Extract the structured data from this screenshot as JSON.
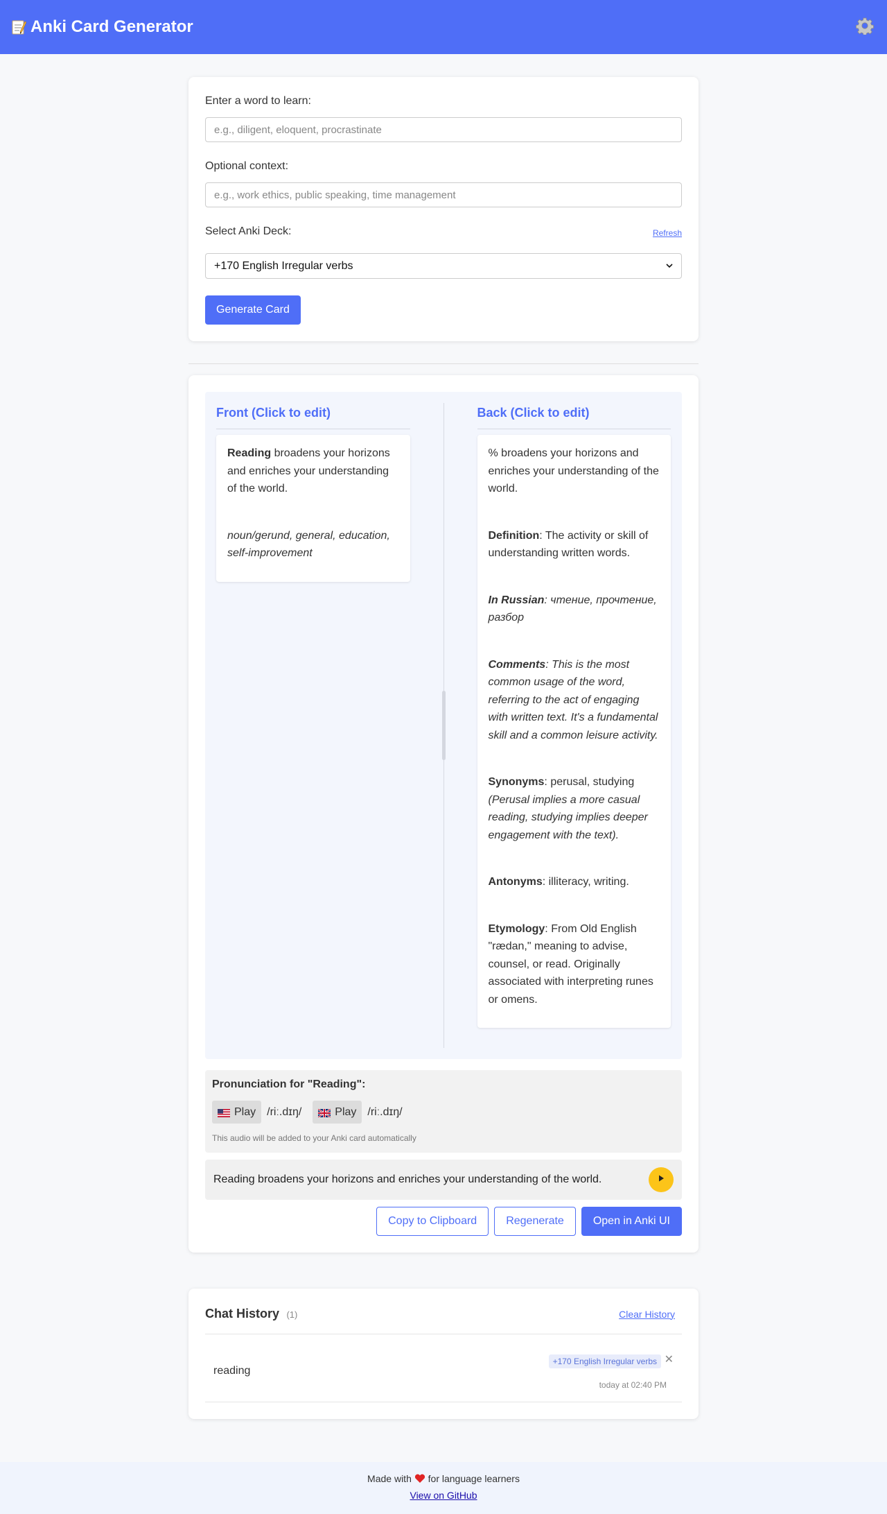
{
  "header": {
    "title": "Anki Card Generator",
    "icon": "memo-icon",
    "settings_icon": "gear-icon"
  },
  "form": {
    "word_label": "Enter a word to learn:",
    "word_placeholder": "e.g., diligent, eloquent, procrastinate",
    "word_value": "",
    "context_label": "Optional context:",
    "context_placeholder": "e.g., work ethics, public speaking, time management",
    "context_value": "",
    "deck_label": "Select Anki Deck:",
    "refresh_label": "Refresh",
    "deck_selected": "+170 English Irregular verbs",
    "generate_label": "Generate Card"
  },
  "card": {
    "front_title": "Front (Click to edit)",
    "front_word": "Reading",
    "front_sentence_rest": " broadens your horizons and enriches your understanding of the world.",
    "front_tags": "noun/gerund, general, education, self-improvement",
    "back_title": "Back (Click to edit)",
    "back_sentence": "% broadens your horizons and enriches your understanding of the world.",
    "definition_label": "Definition",
    "definition_text": ": The activity or skill of understanding written words.",
    "russian_label": "In Russian",
    "russian_text": ": чтение, прочтение, разбор",
    "comments_label": "Comments",
    "comments_text": ": This is the most common usage of the word, referring to the act of engaging with written text. It's a fundamental skill and a common leisure activity.",
    "synonyms_label": "Synonyms",
    "synonyms_text": ": perusal, studying ",
    "synonyms_note": "(Perusal implies a more casual reading, studying implies deeper engagement with the text).",
    "antonyms_label": "Antonyms",
    "antonyms_text": ": illiteracy, writing.",
    "etymology_label": "Etymology",
    "etymology_text": ": From Old English \"rædan,\" meaning to advise, counsel, or read. Originally associated with interpreting runes or omens."
  },
  "pronunciation": {
    "title": "Pronunciation for \"Reading\":",
    "us_label": "Play",
    "us_ipa": "/riː.dɪŋ/",
    "uk_label": "Play",
    "uk_ipa": "/riː.dɪŋ/",
    "note": "This audio will be added to your Anki card automatically"
  },
  "sentence": {
    "text": "Reading broadens your horizons and enriches your understanding of the world."
  },
  "actions": {
    "copy_label": "Copy to Clipboard",
    "regenerate_label": "Regenerate",
    "open_label": "Open in Anki UI"
  },
  "history": {
    "title": "Chat History",
    "count": "(1)",
    "clear_label": "Clear History",
    "items": [
      {
        "word": "reading",
        "deck": "+170 English Irregular verbs",
        "time": "today at 02:40 PM",
        "close": "✕"
      }
    ]
  },
  "footer": {
    "made_prefix": "Made with",
    "made_suffix": "for language learners",
    "github_label": "View on GitHub"
  },
  "colors": {
    "accent": "#4f6ef7",
    "speak_button": "#fcc419",
    "editor_bg": "#f3f6fd"
  }
}
